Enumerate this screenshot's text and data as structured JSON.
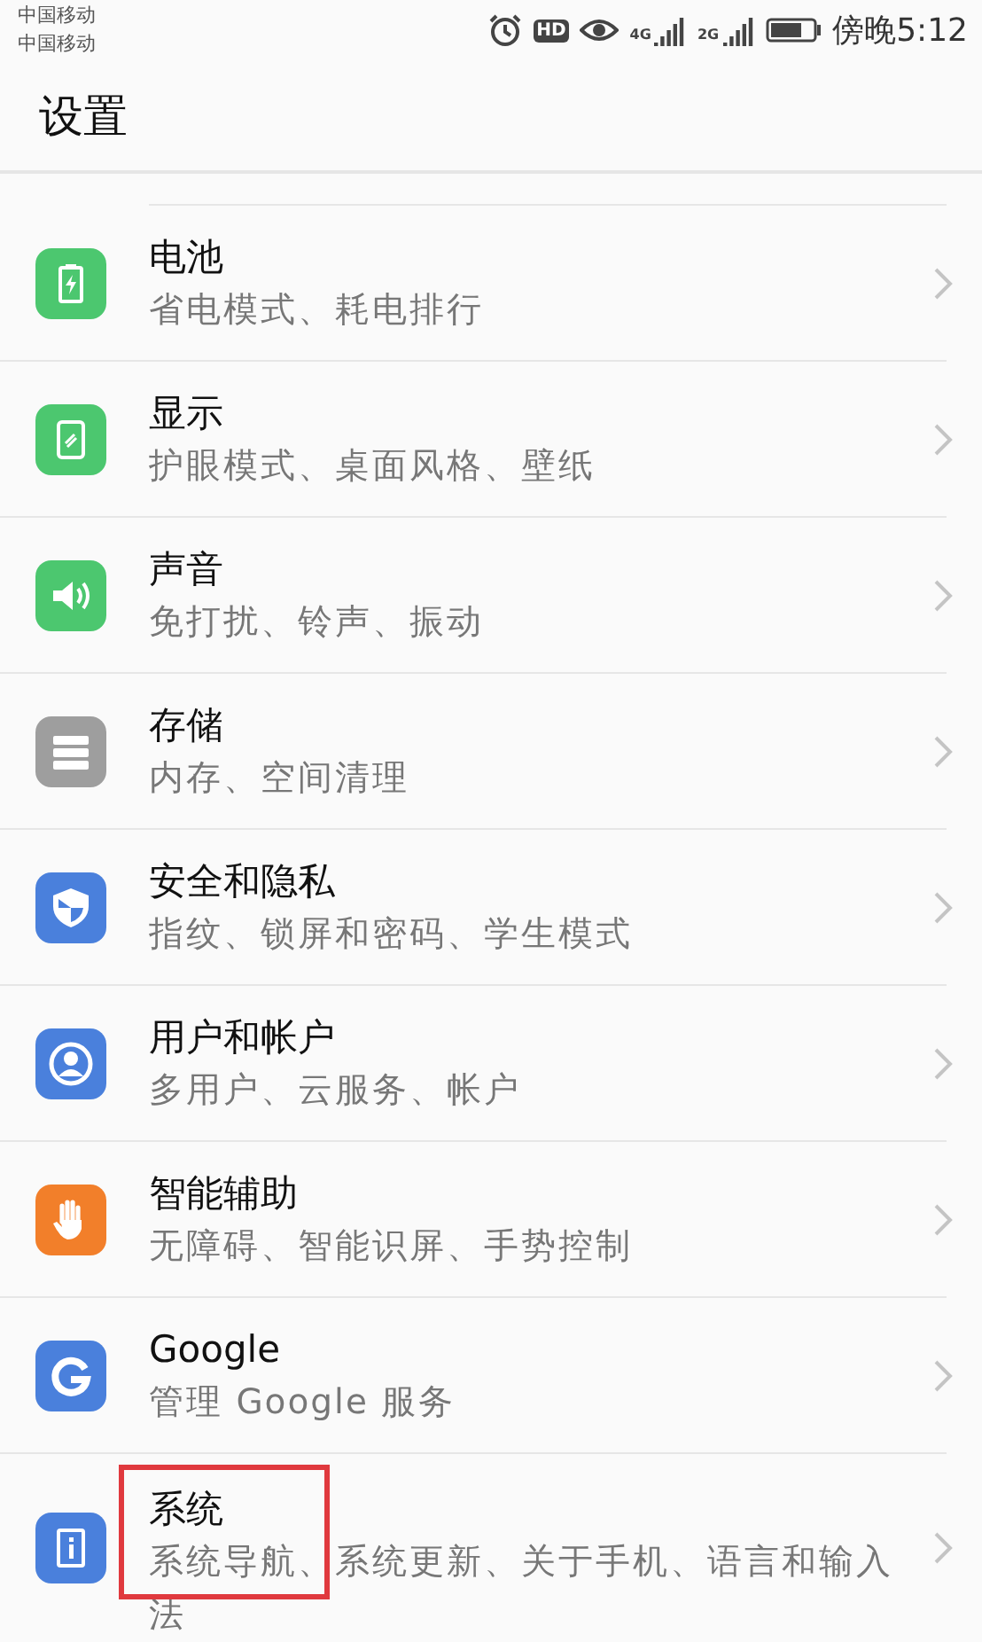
{
  "status_bar": {
    "carriers": [
      "中国移动",
      "中国移动"
    ],
    "hd_badge": "HD",
    "networks": [
      "4G",
      "2G"
    ],
    "time": "傍晚5:12"
  },
  "header": {
    "title": "设置"
  },
  "items": [
    {
      "kind": "battery",
      "color": "#4cc76f",
      "title": "电池",
      "subtitle": "省电模式、耗电排行",
      "highlighted": false
    },
    {
      "kind": "display",
      "color": "#4cc76f",
      "title": "显示",
      "subtitle": "护眼模式、桌面风格、壁纸",
      "highlighted": false
    },
    {
      "kind": "sound",
      "color": "#4cc76f",
      "title": "声音",
      "subtitle": "免打扰、铃声、振动",
      "highlighted": false
    },
    {
      "kind": "storage",
      "color": "#9e9e9e",
      "title": "存储",
      "subtitle": "内存、空间清理",
      "highlighted": false
    },
    {
      "kind": "shield",
      "color": "#4a80dc",
      "title": "安全和隐私",
      "subtitle": "指纹、锁屏和密码、学生模式",
      "highlighted": false
    },
    {
      "kind": "user",
      "color": "#4a80dc",
      "title": "用户和帐户",
      "subtitle": "多用户、云服务、帐户",
      "highlighted": false
    },
    {
      "kind": "hand",
      "color": "#f27f2a",
      "title": "智能辅助",
      "subtitle": "无障碍、智能识屏、手势控制",
      "highlighted": false
    },
    {
      "kind": "google",
      "color": "#4a80dc",
      "title": "Google",
      "subtitle": "管理 Google 服务",
      "highlighted": false
    },
    {
      "kind": "info",
      "color": "#4a80dc",
      "title": "系统",
      "subtitle": "系统导航、系统更新、关于手机、语言和输入法",
      "highlighted": true
    }
  ]
}
